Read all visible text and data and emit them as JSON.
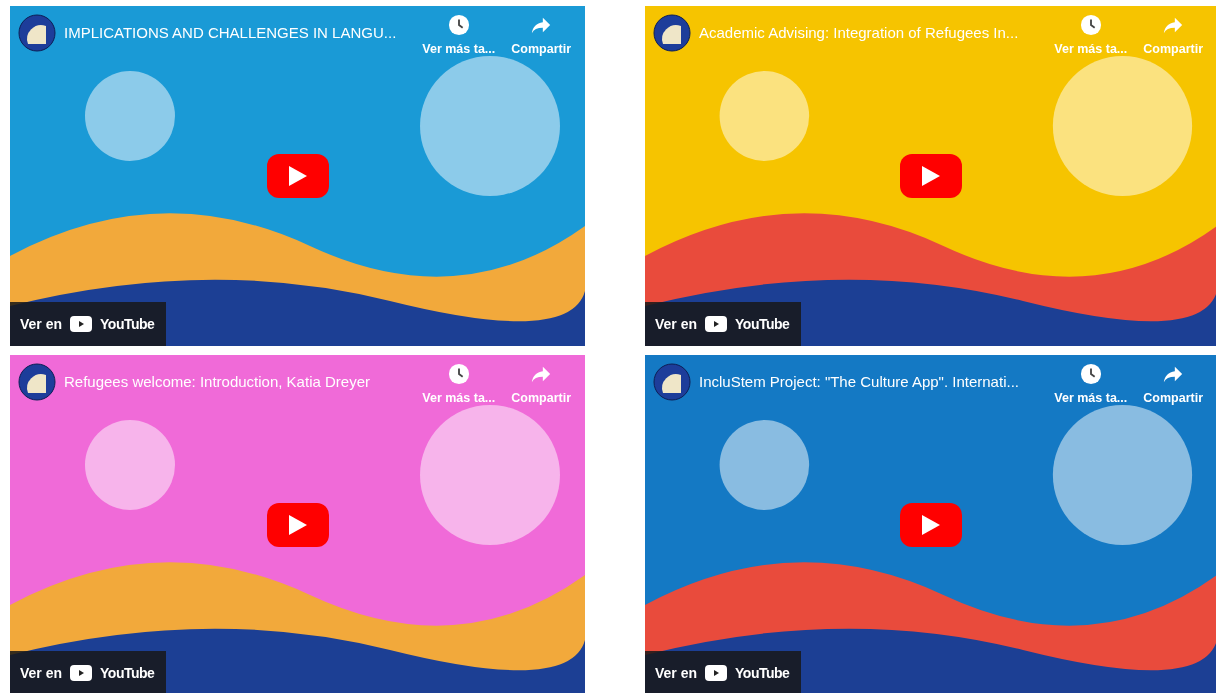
{
  "videos": [
    {
      "title": "IMPLICATIONS AND CHALLENGES IN LANGU...",
      "watch_later": "Ver más ta...",
      "share": "Compartir",
      "watch_on": "Ver en",
      "platform": "YouTube"
    },
    {
      "title": "Academic Advising: Integration of Refugees In...",
      "watch_later": "Ver más ta...",
      "share": "Compartir",
      "watch_on": "Ver en",
      "platform": "YouTube"
    },
    {
      "title": "Refugees welcome: Introduction, Katia Dreyer",
      "watch_later": "Ver más ta...",
      "share": "Compartir",
      "watch_on": "Ver en",
      "platform": "YouTube"
    },
    {
      "title": "IncluStem Project: \"The Culture App\". Internati...",
      "watch_later": "Ver más ta...",
      "share": "Compartir",
      "watch_on": "Ver en",
      "platform": "YouTube"
    }
  ]
}
